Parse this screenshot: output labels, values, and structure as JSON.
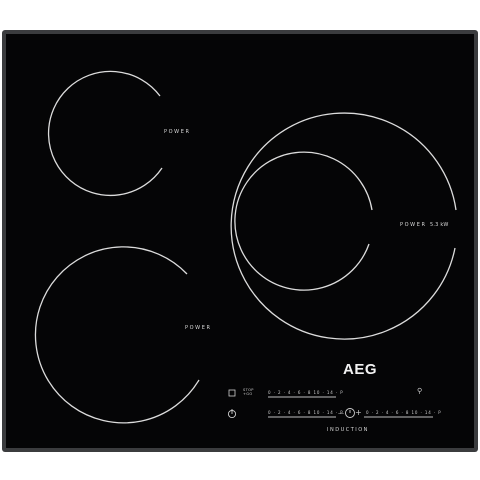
{
  "hob": {
    "brand": "AEG",
    "technology_label": "INDUCTION",
    "zones": [
      {
        "id": "rear-left",
        "label": "POWER"
      },
      {
        "id": "right",
        "label": "POWER",
        "rating": "5.3 kW"
      },
      {
        "id": "front-left",
        "label": "POWER"
      }
    ],
    "controls": {
      "stop_go_label": "STOP\n+GO",
      "scale_upper": "0 · 2 · 4 · 6 · 8 10 · 14 · P",
      "scale_lower_left": "0 · 2 · 4 · 6 · 8 10 · 14 · P",
      "scale_lower_right": "0 · 2 · 4 · 6 · 8 10 · 14 · P",
      "minus_symbol": "—",
      "timer_symbol": "⏲",
      "plus_symbol": "+",
      "power_symbol": "⏻",
      "lock_symbol": "⊡",
      "child_lock_symbol": "⚲"
    },
    "colors": {
      "frame": "#3a3b3d",
      "glass": "#050506",
      "markings": "#e6e6e6"
    }
  }
}
